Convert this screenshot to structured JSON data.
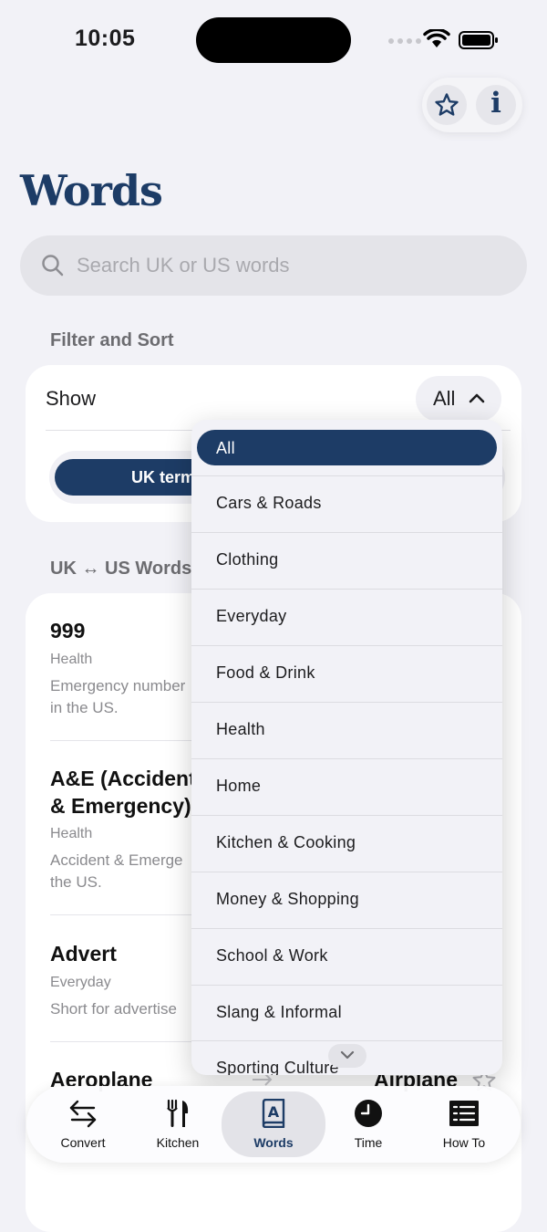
{
  "status_bar": {
    "time": "10:05"
  },
  "header": {
    "title": "Words"
  },
  "search": {
    "placeholder": "Search UK or US words"
  },
  "filter": {
    "section_title": "Filter and Sort",
    "show_label": "Show",
    "selected_value": "All",
    "segment_active_label": "UK terms"
  },
  "dropdown": {
    "options": [
      "All",
      "Cars & Roads",
      "Clothing",
      "Everyday",
      "Food & Drink",
      "Health",
      "Home",
      "Kitchen & Cooking",
      "Money & Shopping",
      "School & Work",
      "Slang & Informal",
      "Sporting Culture"
    ]
  },
  "words": {
    "section_title": "UK ↔ US Words",
    "rows": [
      {
        "term": "999",
        "category": "Health",
        "desc1": "Emergency number",
        "desc2": "in the US."
      },
      {
        "term1": "A&E (Accident",
        "term2": "& Emergency)",
        "category": "Health",
        "desc1": "Accident & Emerge",
        "desc2": "the US."
      },
      {
        "term": "Advert",
        "category": "Everyday",
        "desc1": "Short for advertise"
      },
      {
        "term": "Aeroplane",
        "us_term": "Airplane"
      }
    ]
  },
  "tabs": [
    {
      "label": "Convert"
    },
    {
      "label": "Kitchen"
    },
    {
      "label": "Words"
    },
    {
      "label": "Time"
    },
    {
      "label": "How To"
    }
  ],
  "colors": {
    "accent": "#1D3C66",
    "background": "#F2F2F7"
  }
}
